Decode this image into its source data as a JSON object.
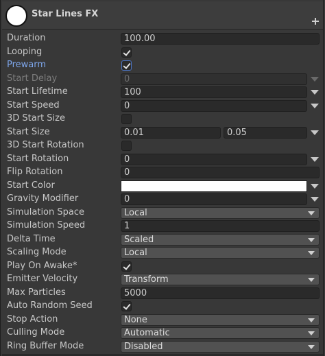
{
  "header": {
    "title": "Star Lines FX",
    "icon": "white-circle-icon"
  },
  "rows": {
    "duration": {
      "label": "Duration",
      "value": "100.00"
    },
    "looping": {
      "label": "Looping",
      "checked": true
    },
    "prewarm": {
      "label": "Prewarm",
      "checked": true
    },
    "start_delay": {
      "label": "Start Delay",
      "value": "0"
    },
    "start_lifetime": {
      "label": "Start Lifetime",
      "value": "100"
    },
    "start_speed": {
      "label": "Start Speed",
      "value": "0"
    },
    "start_size_3d": {
      "label": "3D Start Size",
      "checked": false
    },
    "start_size": {
      "label": "Start Size",
      "value_min": "0.01",
      "value_max": "0.05"
    },
    "start_rotation_3d": {
      "label": "3D Start Rotation",
      "checked": false
    },
    "start_rotation": {
      "label": "Start Rotation",
      "value": "0"
    },
    "flip_rotation": {
      "label": "Flip Rotation",
      "value": "0"
    },
    "start_color": {
      "label": "Start Color",
      "color": "#ffffff"
    },
    "gravity_modifier": {
      "label": "Gravity Modifier",
      "value": "0"
    },
    "simulation_space": {
      "label": "Simulation Space",
      "value": "Local"
    },
    "simulation_speed": {
      "label": "Simulation Speed",
      "value": "1"
    },
    "delta_time": {
      "label": "Delta Time",
      "value": "Scaled"
    },
    "scaling_mode": {
      "label": "Scaling Mode",
      "value": "Local"
    },
    "play_on_awake": {
      "label": "Play On Awake*",
      "checked": true
    },
    "emitter_velocity": {
      "label": "Emitter Velocity",
      "value": "Transform"
    },
    "max_particles": {
      "label": "Max Particles",
      "value": "5000"
    },
    "auto_random_seed": {
      "label": "Auto Random Seed",
      "checked": true
    },
    "stop_action": {
      "label": "Stop Action",
      "value": "None"
    },
    "culling_mode": {
      "label": "Culling Mode",
      "value": "Automatic"
    },
    "ring_buffer_mode": {
      "label": "Ring Buffer Mode",
      "value": "Disabled"
    }
  },
  "colors": {
    "accent": "#7ea7ec",
    "panel": "#383838",
    "field": "#2a2a2a"
  }
}
